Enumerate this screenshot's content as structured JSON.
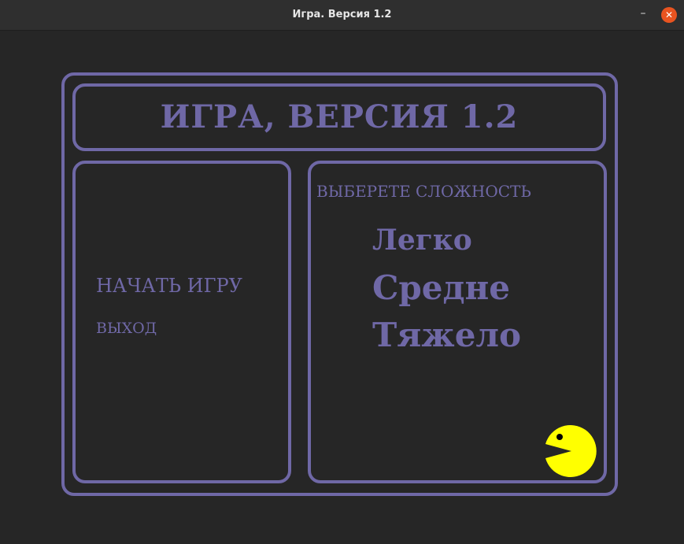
{
  "window": {
    "title": "Игра. Версия 1.2",
    "minimize_glyph": "–",
    "close_glyph": "✕"
  },
  "header": {
    "title": "ИГРА, ВЕРСИЯ 1.2"
  },
  "menu": {
    "start_label": "НАЧАТЬ ИГРУ",
    "exit_label": "ВЫХОД"
  },
  "difficulty": {
    "heading": "ВЫБЕРЕТЕ СЛОЖНОСТЬ",
    "options": [
      "Легко",
      "Средне",
      "Тяжело"
    ]
  },
  "icons": {
    "mascot": "pacman-icon"
  },
  "colors": {
    "background": "#262626",
    "accent": "#6f68a6",
    "mascot": "#ffff00",
    "close_button": "#e95420"
  }
}
